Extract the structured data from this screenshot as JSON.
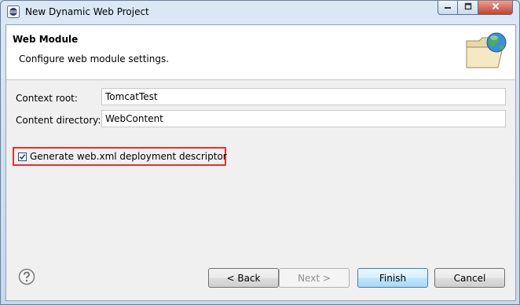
{
  "window": {
    "title": "New Dynamic Web Project",
    "icons": {
      "app": "eclipse-icon",
      "minimize": "minimize-icon",
      "maximize": "maximize-icon",
      "close": "close-icon"
    }
  },
  "banner": {
    "title": "Web Module",
    "description": "Configure web module settings.",
    "icon": "folder-globe-icon"
  },
  "form": {
    "context_root": {
      "label": "Context root:",
      "value": "TomcatTest"
    },
    "content_directory": {
      "label": "Content directory:",
      "value": "WebContent"
    },
    "generate_descriptor": {
      "label": "Generate web.xml deployment descriptor",
      "checked": true
    }
  },
  "footer": {
    "help_icon": "help-icon",
    "back_label": "< Back",
    "next_label": "Next >",
    "finish_label": "Finish",
    "cancel_label": "Cancel"
  },
  "colors": {
    "highlight_border": "#e8312a",
    "default_button_border": "#3c7fb1"
  }
}
